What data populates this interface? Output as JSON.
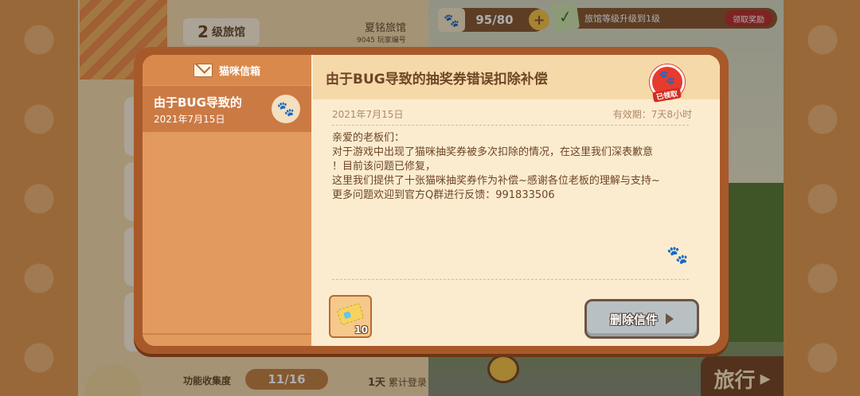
{
  "background": {
    "hotel_level_number": "2",
    "hotel_level_suffix": "级旅馆",
    "hotel_name": "夏铭旅馆",
    "player_id": "9045 玩家编号",
    "ticket_counter": "95/80",
    "task_text": "旅馆等级升级到1级",
    "claim_reward_label": "领取奖励",
    "collection_label": "功能收集度",
    "collection_value": "11/16",
    "login_days": "1天",
    "login_label": "累计登录",
    "travel_label": "旅行"
  },
  "mailbox": {
    "title": "猫咪信箱",
    "items": [
      {
        "title": "由于BUG导致的",
        "date": "2021年7月15日"
      }
    ]
  },
  "mail": {
    "title": "由于BUG导致的抽奖券错误扣除补偿",
    "claimed_stamp": "已领取",
    "date": "2021年7月15日",
    "validity": "有效期：7天8小时",
    "body": "亲爱的老板们：\n对于游戏中出现了猫咪抽奖券被多次扣除的情况，在这里我们深表歉意\n！目前该问题已修复，\n这里我们提供了十张猫咪抽奖券作为补偿~感谢各位老板的理解与支持~\n更多问题欢迎到官方Q群进行反馈：991833506",
    "reward_count": "10",
    "delete_label": "删除信件"
  },
  "colors": {
    "frame": "#a8592a",
    "sidebar": "#e39a5e",
    "sidebar_selected": "#cc7a44",
    "content_bg": "#fbecd0",
    "stamp_red": "#e63b2e",
    "button_gray": "#b9c0c3"
  },
  "icons": [
    "envelope-icon",
    "paw-icon",
    "ticket-icon",
    "play-icon",
    "plus-icon",
    "check-icon"
  ]
}
